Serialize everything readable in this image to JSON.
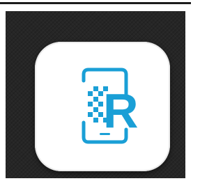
{
  "app_icon": {
    "glyph_letter": "R",
    "icon_name": "phone-scan-r-icon",
    "accent_color": "#1a9fd6",
    "tile_color": "#ffffff",
    "background_color": "#262626"
  }
}
